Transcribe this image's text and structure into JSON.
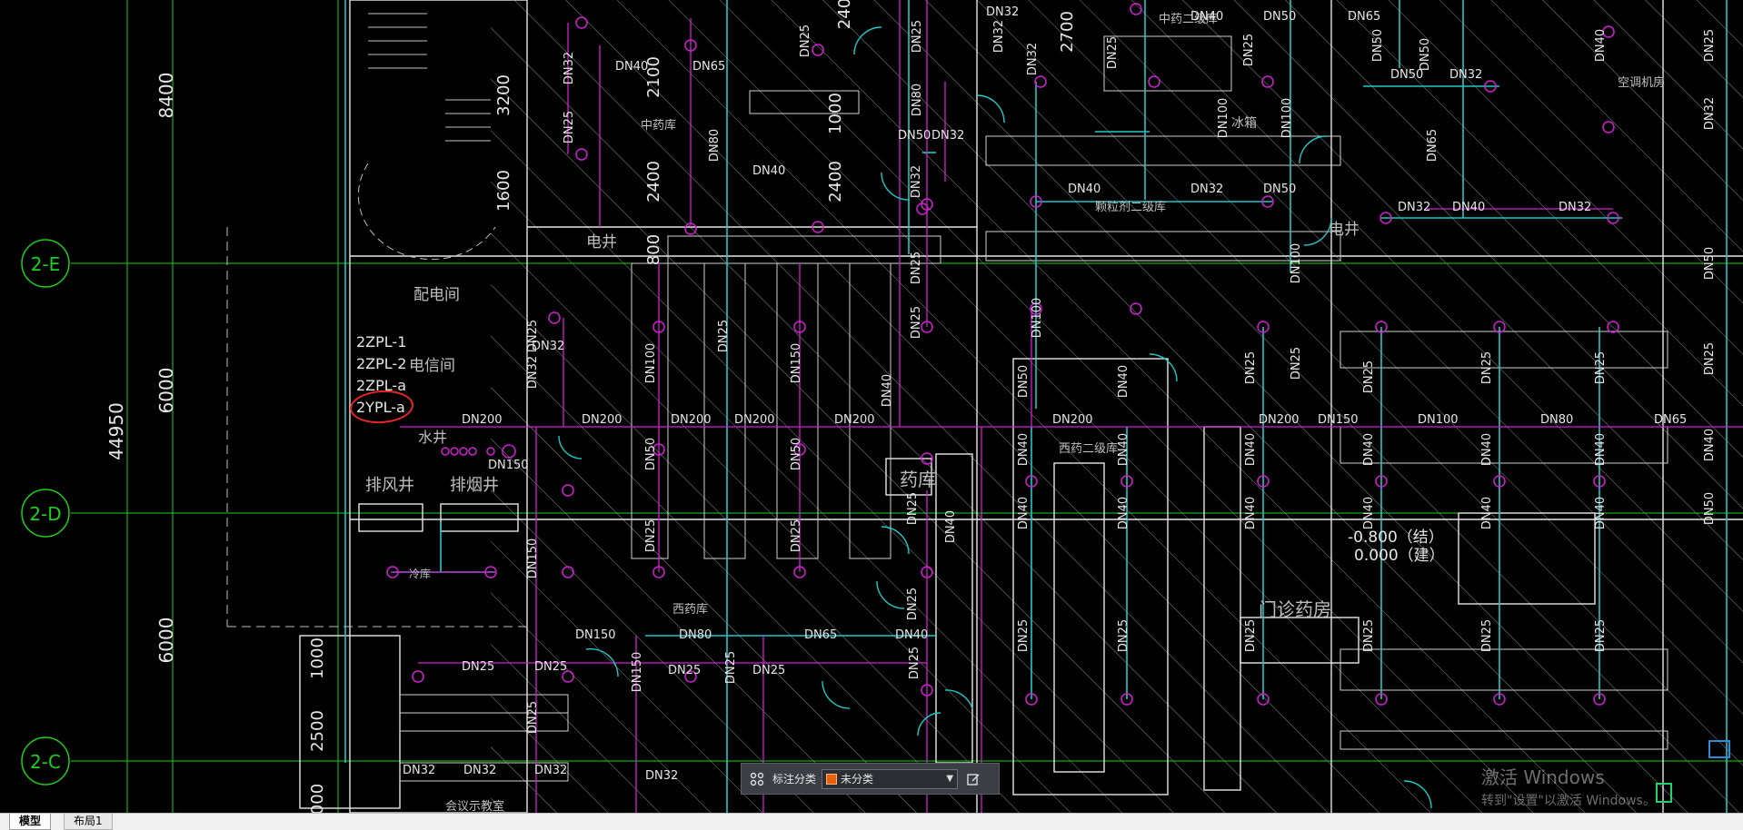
{
  "colors": {
    "grid": "#1bd11b",
    "cyan": "#1ec8c8",
    "magenta": "#d21fd2",
    "white": "#e6e6e6",
    "hatch": "#bfbfbf",
    "red_annotation": "#e8262a"
  },
  "axes": {
    "rows": [
      "2-E",
      "2-D",
      "2-C"
    ],
    "dims_outer": [
      "8400",
      "6000",
      "6000"
    ],
    "dim_total": "44950",
    "dims_inner": [
      "1000",
      "2500",
      "000"
    ]
  },
  "rooms": [
    "配电间",
    "电信间",
    "水井",
    "排风井",
    "排烟井",
    "电井",
    "电井",
    "中药库",
    "西药库",
    "药库",
    "西药二级库",
    "门诊药房",
    "冷库",
    "中药二级库",
    "颗粒剂二级库",
    "冰箱",
    "空调机房",
    "会议示教室",
    "西药二级库",
    "西药二级库"
  ],
  "risers": [
    "2ZPL-1",
    "2ZPL-2",
    "2ZPL-a",
    "2YPL-a"
  ],
  "pipes": {
    "main_line": [
      "DN200",
      "DN200",
      "DN200",
      "DN200",
      "DN200",
      "DN200",
      "DN200",
      "DN150",
      "DN100",
      "DN80",
      "DN65"
    ],
    "labels": [
      "DN32",
      "DN40",
      "DN65",
      "DN32",
      "DN25",
      "DN32",
      "DN80",
      "DN40",
      "DN32",
      "DN25",
      "DN80",
      "DN50",
      "DN32",
      "DN32",
      "DN25",
      "DN32",
      "DN50",
      "DN65",
      "DN32",
      "DN40",
      "DN50",
      "DN100",
      "DN25",
      "DN40",
      "DN25",
      "DN32",
      "DN40",
      "DN32",
      "DN32",
      "DN40",
      "DN32",
      "DN50",
      "DN100",
      "DN25",
      "DN50",
      "DN40",
      "DN150",
      "DN80",
      "DN65",
      "DN40",
      "DN25",
      "DN25",
      "DN25",
      "DN25",
      "DN32",
      "DN32",
      "DN32",
      "DN25",
      "DN150",
      "DN50",
      "DN32",
      "DN32",
      "DN25",
      "DN25",
      "DN25",
      "DN25"
    ]
  },
  "dimensions_text": [
    "3200",
    "1600",
    "2100",
    "2400",
    "800",
    "1000",
    "2400",
    "2700",
    "240"
  ],
  "elevations": [
    "-0.800（结）",
    "0.000（建）"
  ],
  "toolbar": {
    "grid_icon": "grid-icon",
    "label": "标注分类",
    "selected": "未分类",
    "swatch_color": "#e8620c",
    "edit_icon": "edit-icon"
  },
  "layout_tabs": [
    "模型",
    "布局1"
  ],
  "watermark": {
    "title": "激活 Windows",
    "subtitle": "转到\"设置\"以激活 Windows。"
  }
}
